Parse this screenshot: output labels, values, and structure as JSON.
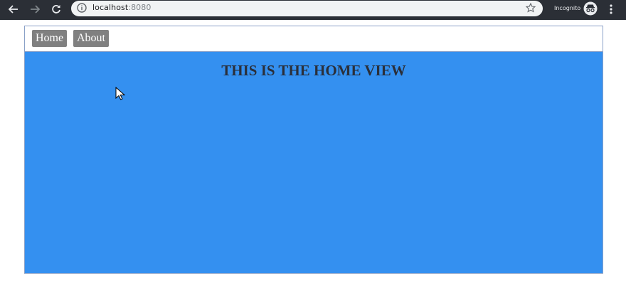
{
  "browser": {
    "url_host": "localhost",
    "url_port": ":8080",
    "incognito_label": "Incognito"
  },
  "nav": {
    "home_label": "Home",
    "about_label": "About"
  },
  "main": {
    "heading": "THIS IS THE HOME VIEW"
  },
  "colors": {
    "content_bg": "#3490f0",
    "nav_button_bg": "#808080",
    "chrome_bg": "#2b2f36"
  }
}
